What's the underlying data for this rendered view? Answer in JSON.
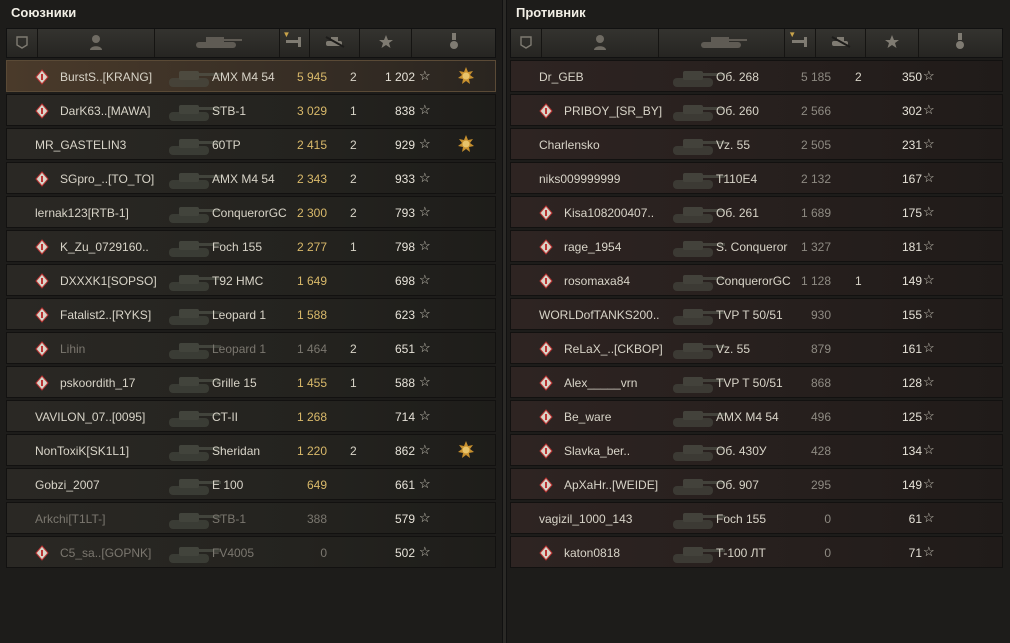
{
  "allies": {
    "title": "Союзники",
    "rows": [
      {
        "clan_icon": "clan-emblem-icon",
        "name": "BurstS..[KRANG]",
        "tank": "AMX M4 54",
        "damage": "5 945",
        "frags": "2",
        "xp": "1 202",
        "medal": true,
        "highlight": true,
        "dead": false
      },
      {
        "clan_icon": "clan-emblem-icon",
        "name": "DarK63..[MAWA]",
        "tank": "STB-1",
        "damage": "3 029",
        "frags": "1",
        "xp": "838",
        "medal": false,
        "highlight": false,
        "dead": false
      },
      {
        "clan_icon": "",
        "name": "MR_GASTELIN3",
        "tank": "60TP",
        "damage": "2 415",
        "frags": "2",
        "xp": "929",
        "medal": true,
        "highlight": false,
        "dead": false
      },
      {
        "clan_icon": "clan-emblem-icon",
        "name": "SGpro_..[TO_TO]",
        "tank": "AMX M4 54",
        "damage": "2 343",
        "frags": "2",
        "xp": "933",
        "medal": false,
        "highlight": false,
        "dead": false
      },
      {
        "clan_icon": "",
        "name": "lernak123[RTB-1]",
        "tank": "ConquerorGC",
        "damage": "2 300",
        "frags": "2",
        "xp": "793",
        "medal": false,
        "highlight": false,
        "dead": false
      },
      {
        "clan_icon": "clan-emblem-icon",
        "name": "K_Zu_0729160..",
        "tank": "Foch 155",
        "damage": "2 277",
        "frags": "1",
        "xp": "798",
        "medal": false,
        "highlight": false,
        "dead": false
      },
      {
        "clan_icon": "clan-emblem-icon",
        "name": "DXXXK1[SOPSO]",
        "tank": "T92 HMC",
        "damage": "1 649",
        "frags": "",
        "xp": "698",
        "medal": false,
        "highlight": false,
        "dead": false
      },
      {
        "clan_icon": "clan-emblem-icon",
        "name": "Fatalist2..[RYKS]",
        "tank": "Leopard 1",
        "damage": "1 588",
        "frags": "",
        "xp": "623",
        "medal": false,
        "highlight": false,
        "dead": false
      },
      {
        "clan_icon": "clan-emblem-icon",
        "name": "Lihin",
        "tank": "Leopard 1",
        "damage": "1 464",
        "frags": "2",
        "xp": "651",
        "medal": false,
        "highlight": false,
        "dead": true
      },
      {
        "clan_icon": "clan-emblem-icon",
        "name": "pskoordith_17",
        "tank": "Grille 15",
        "damage": "1 455",
        "frags": "1",
        "xp": "588",
        "medal": false,
        "highlight": false,
        "dead": false
      },
      {
        "clan_icon": "",
        "name": "VAVILON_07..[0095]",
        "tank": "CT-II",
        "damage": "1 268",
        "frags": "",
        "xp": "714",
        "medal": false,
        "highlight": false,
        "dead": false
      },
      {
        "clan_icon": "",
        "name": "NonToxiK[SK1L1]",
        "tank": "Sheridan",
        "damage": "1 220",
        "frags": "2",
        "xp": "862",
        "medal": true,
        "highlight": false,
        "dead": false
      },
      {
        "clan_icon": "",
        "name": "Gobzi_2007",
        "tank": "E 100",
        "damage": "649",
        "frags": "",
        "xp": "661",
        "medal": false,
        "highlight": false,
        "dead": false
      },
      {
        "clan_icon": "",
        "name": "Arkchi[T1LT-]",
        "tank": "STB-1",
        "damage": "388",
        "frags": "",
        "xp": "579",
        "medal": false,
        "highlight": false,
        "dead": true
      },
      {
        "clan_icon": "clan-emblem-icon",
        "name": "C5_sa..[GOPNK]",
        "tank": "FV4005",
        "damage": "0",
        "frags": "",
        "xp": "502",
        "medal": false,
        "highlight": false,
        "dead": true
      }
    ]
  },
  "enemies": {
    "title": "Противник",
    "rows": [
      {
        "clan_icon": "",
        "name": "Dr_GEB",
        "tank": "Об. 268",
        "damage": "5 185",
        "frags": "2",
        "xp": "350"
      },
      {
        "clan_icon": "clan-emblem-icon",
        "name": "PRIBOY_[SR_BY]",
        "tank": "Об. 260",
        "damage": "2 566",
        "frags": "",
        "xp": "302"
      },
      {
        "clan_icon": "",
        "name": "Charlensko",
        "tank": "Vz. 55",
        "damage": "2 505",
        "frags": "",
        "xp": "231"
      },
      {
        "clan_icon": "",
        "name": "niks009999999",
        "tank": "T110E4",
        "damage": "2 132",
        "frags": "",
        "xp": "167"
      },
      {
        "clan_icon": "clan-emblem-icon",
        "name": "Kisa108200407..",
        "tank": "Об. 261",
        "damage": "1 689",
        "frags": "",
        "xp": "175"
      },
      {
        "clan_icon": "clan-emblem-icon",
        "name": "rage_1954",
        "tank": "S. Conqueror",
        "damage": "1 327",
        "frags": "",
        "xp": "181"
      },
      {
        "clan_icon": "clan-emblem-icon",
        "name": "rosomaxa84",
        "tank": "ConquerorGC",
        "damage": "1 128",
        "frags": "1",
        "xp": "149"
      },
      {
        "clan_icon": "",
        "name": "WORLDofTANKS200..",
        "tank": "TVP T 50/51",
        "damage": "930",
        "frags": "",
        "xp": "155"
      },
      {
        "clan_icon": "clan-emblem-icon",
        "name": "ReLaX_..[CKBOP]",
        "tank": "Vz. 55",
        "damage": "879",
        "frags": "",
        "xp": "161"
      },
      {
        "clan_icon": "clan-emblem-icon",
        "name": "Alex_____vrn",
        "tank": "TVP T 50/51",
        "damage": "868",
        "frags": "",
        "xp": "128"
      },
      {
        "clan_icon": "clan-emblem-icon",
        "name": "Be_ware",
        "tank": "AMX M4 54",
        "damage": "496",
        "frags": "",
        "xp": "125"
      },
      {
        "clan_icon": "clan-emblem-icon",
        "name": "Slavka_ber..",
        "tank": "Об. 430У",
        "damage": "428",
        "frags": "",
        "xp": "134"
      },
      {
        "clan_icon": "clan-emblem-icon",
        "name": "ApXaHr..[WEIDE]",
        "tank": "Об. 907",
        "damage": "295",
        "frags": "",
        "xp": "149"
      },
      {
        "clan_icon": "",
        "name": "vagizil_1000_143",
        "tank": "Foch 155",
        "damage": "0",
        "frags": "",
        "xp": "61"
      },
      {
        "clan_icon": "clan-emblem-icon",
        "name": "katon0818",
        "tank": "Т-100 ЛТ",
        "damage": "0",
        "frags": "",
        "xp": "71"
      }
    ]
  },
  "headers": [
    {
      "icon": "rank-badge-icon"
    },
    {
      "icon": "player-icon"
    },
    {
      "icon": "tank-icon"
    },
    {
      "icon": "damage-icon",
      "sorted": true
    },
    {
      "icon": "frags-icon"
    },
    {
      "icon": "xp-star-icon"
    },
    {
      "icon": "medal-icon"
    }
  ],
  "colors": {
    "damage": "#d9b96a",
    "highlight": "#4a3a2a",
    "title": "#f2efe6"
  }
}
